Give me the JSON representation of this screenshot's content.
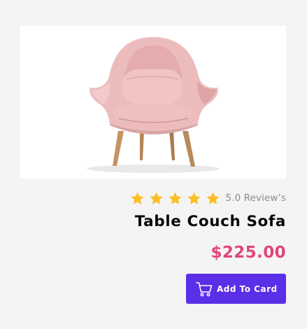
{
  "product": {
    "image_alt": "Pink upholstered lounge armchair with wooden legs",
    "rating": {
      "value": 5,
      "max": 5,
      "text": "5.0 Review’s"
    },
    "title": "Table Couch Sofa",
    "price": "$225.00",
    "add_to_cart_label": "Add To Card"
  },
  "icons": {
    "star": "star-icon",
    "cart": "cart-icon"
  },
  "colors": {
    "star": "#fbbf24",
    "price": "#e0457b",
    "button": "#5b2ee8",
    "title": "#0b0b0b",
    "reviews": "#8a8a8a"
  }
}
